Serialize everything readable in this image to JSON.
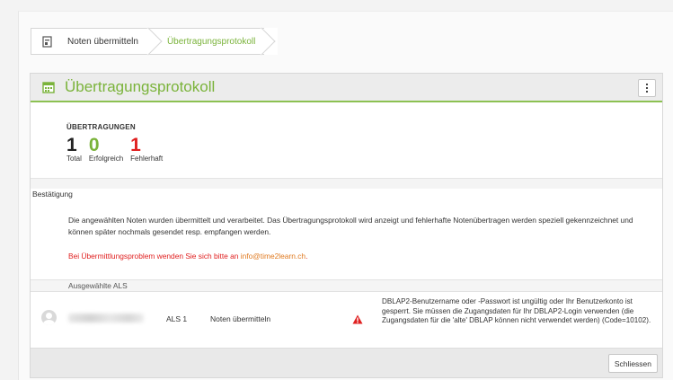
{
  "breadcrumb": {
    "items": [
      {
        "label": "Noten übermitteln"
      },
      {
        "label": "Übertragungsprotokoll"
      }
    ]
  },
  "panel": {
    "title": "Übertragungsprotokoll"
  },
  "stats": {
    "title": "ÜBERTRAGUNGEN",
    "total": {
      "value": "1",
      "label": "Total"
    },
    "success": {
      "value": "0",
      "label": "Erfolgreich"
    },
    "failed": {
      "value": "1",
      "label": "Fehlerhaft"
    }
  },
  "confirmation": {
    "label": "Bestätigung",
    "message": "Die angewählten Noten wurden übermittelt und verarbeitet. Das Übertragungsprotokoll wird anzeigt und fehlerhafte Notenübertragen werden speziell gekennzeichnet und können später nochmals gesendet resp. empfangen werden.",
    "problem_prefix": "Bei Übermittlungsproblem wenden Sie sich bitte an ",
    "problem_email": "info@time2learn.ch",
    "problem_suffix": "."
  },
  "selected": {
    "header": "Ausgewählte ALS",
    "rows": [
      {
        "als": "ALS 1",
        "action": "Noten übermitteln",
        "error": "DBLAP2-Benutzername oder -Passwort ist ungültig oder Ihr Benutzerkonto ist gesperrt. Sie müssen die Zugangsdaten für Ihr DBLAP2-Login verwenden (die Zugangsdaten für die 'alte' DBLAP können nicht verwendet werden) (Code=10102)."
      }
    ]
  },
  "footer": {
    "close_label": "Schliessen"
  },
  "colors": {
    "accent": "#7ab33a",
    "error": "#e02020",
    "link": "#e07a20"
  }
}
